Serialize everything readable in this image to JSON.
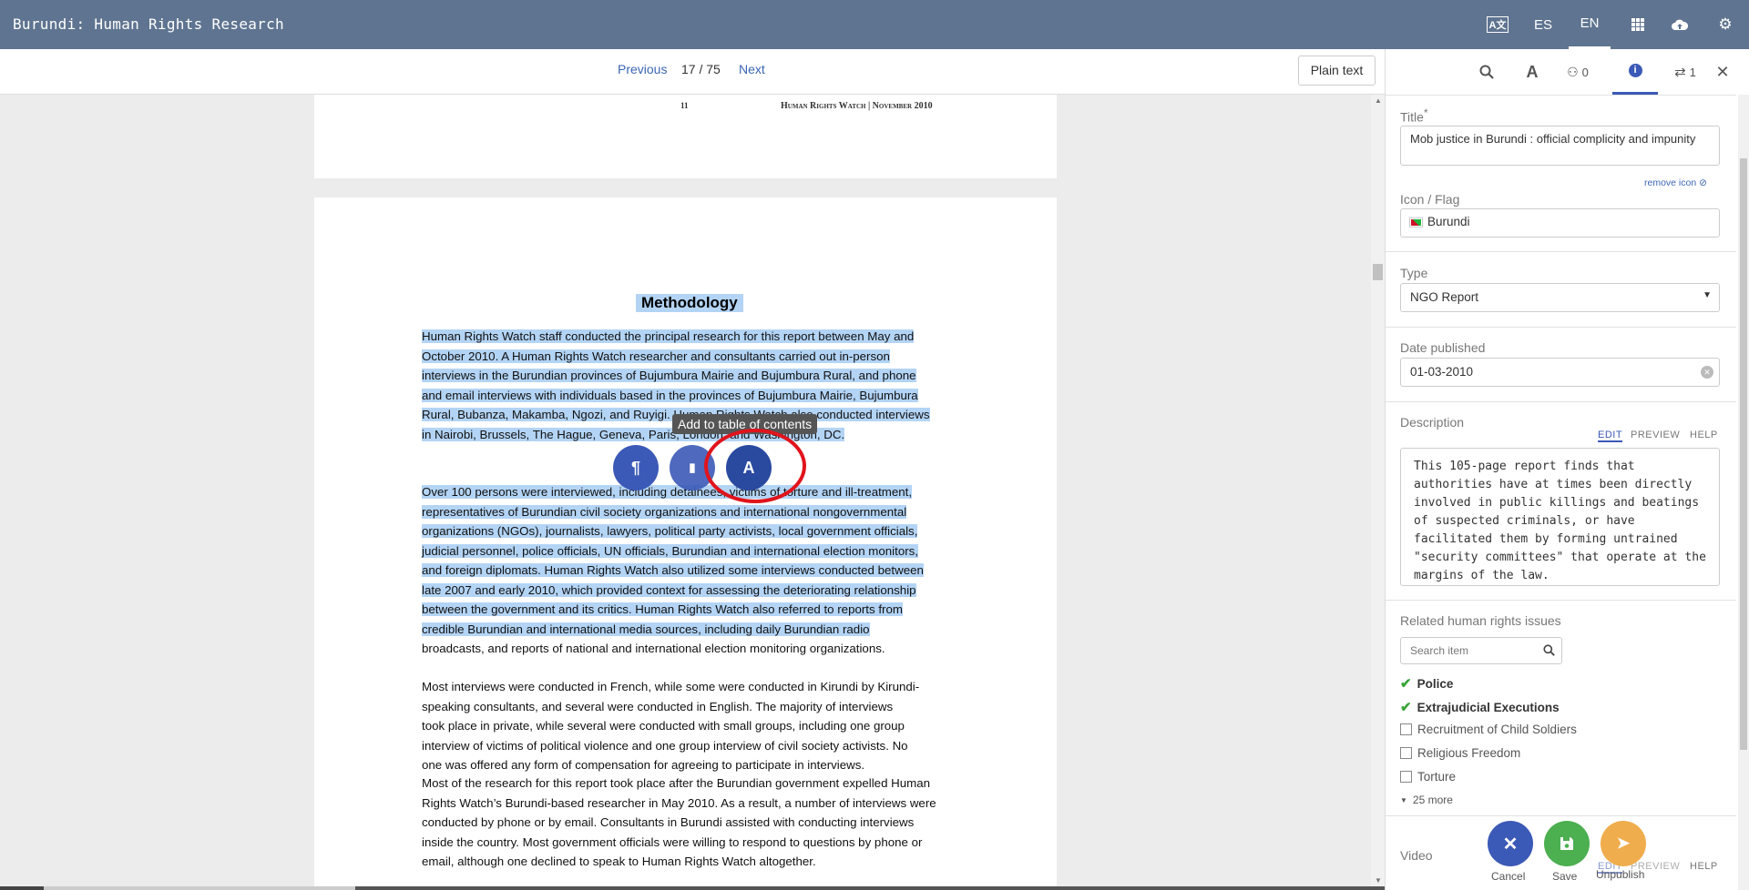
{
  "app": {
    "title": "Burundi: Human Rights Research"
  },
  "topbar": {
    "lang_icon": "A文",
    "languages": [
      "ES",
      "EN"
    ],
    "active_language": "EN",
    "icons": [
      "translate-icon",
      "grid-icon",
      "cloud-upload-icon",
      "gear-icon"
    ]
  },
  "pager": {
    "previous": "Previous",
    "position": "17 / 75",
    "next": "Next",
    "plain_text": "Plain text"
  },
  "document": {
    "prev_page_number": "11",
    "prev_page_header": "Human Rights Watch | November 2010",
    "heading": "Methodology",
    "paragraphs": [
      [
        "Human Rights Watch staff conducted the principal research for this report between May and",
        "October 2010. A Human Rights Watch researcher and consultants carried out in-person",
        "interviews in the Burundian provinces of Bujumbura Mairie and Bujumbura Rural, and phone",
        "and email interviews with individuals based in the provinces of Bujumbura Mairie, Bujumbura",
        "Rural, Bubanza, Makamba, Ngozi, and Ruyigi. Human Rights Watch also conducted interviews",
        "in Nairobi, Brussels, The Hague, Geneva, Paris, London, and Washington, DC."
      ],
      [
        "Over 100 persons were interviewed, including detainees, victims of torture and ill-treatment,",
        "representatives of Burundian civil society organizations and international nongovernmental",
        "organizations (NGOs), journalists, lawyers, political party activists, local government officials,",
        "judicial personnel, police officials, UN officials, Burundian and international election monitors,",
        "and foreign diplomats. Human Rights Watch also utilized some interviews conducted between",
        "late 2007 and early 2010, which provided context for assessing the deteriorating relationship",
        "between the government and its critics. Human Rights Watch also referred to reports from",
        "credible Burundian and international media sources, including daily Burundian radio",
        "broadcasts, and reports of national and international election monitoring organizations."
      ],
      [
        "Most interviews were conducted in French, while some were conducted in Kirundi by Kirundi-",
        "speaking consultants, and several were conducted in English. The majority of interviews",
        "took place in private, while several were conducted with small groups, including one group",
        "interview of victims of political violence and one group interview of civil society activists. No",
        "one was offered any form of compensation for agreeing to participate in interviews."
      ],
      [
        "Most of the research for this report took place after the Burundian government expelled Human",
        "Rights Watch’s Burundi-based researcher in May 2010. As a result, a number of interviews were",
        "conducted by phone or by email. Consultants in Burundi assisted with conducting interviews",
        "inside the country. Most government officials were willing to respond to questions by phone or",
        "email, although one declined to speak to Human Rights Watch altogether."
      ]
    ]
  },
  "selection_tools": {
    "tooltip": "Add to table of contents",
    "buttons": [
      "¶",
      "▮",
      "A"
    ]
  },
  "panel": {
    "tabs": {
      "relationships_count": "0",
      "connections_count": "1"
    },
    "title_label": "Title",
    "required_mark": "*",
    "title_value": "Mob justice in Burundi : official complicity and impunity",
    "remove_icon": "remove icon",
    "icon_label": "Icon / Flag",
    "icon_value": "Burundi",
    "type_label": "Type",
    "type_value": "NGO Report",
    "date_label": "Date published",
    "date_value": "01-03-2010",
    "description_label": "Description",
    "md_tabs": [
      "EDIT",
      "PREVIEW",
      "HELP"
    ],
    "description_value": "This 105-page report finds that authorities have at times been directly involved in public killings and beatings of suspected criminals, or have facilitated them by forming untrained \"security committees\" that operate at the margins of the law.",
    "issues_label": "Related human rights issues",
    "search_placeholder": "Search item",
    "issues": [
      {
        "label": "Police",
        "checked": true
      },
      {
        "label": "Extrajudicial Executions",
        "checked": true
      },
      {
        "label": "Recruitment of Child Soldiers",
        "checked": false
      },
      {
        "label": "Religious Freedom",
        "checked": false
      },
      {
        "label": "Torture",
        "checked": false
      }
    ],
    "more": "25 more",
    "video_label": "Video"
  },
  "actions": {
    "cancel": "Cancel",
    "save": "Save",
    "unpublish": "Unpublish"
  },
  "colors": {
    "topbar": "#5f7490",
    "accent": "#3b59b6",
    "selection": "#b3d4f5",
    "save": "#4caf50",
    "unpublish": "#f0ad4e",
    "highlight_ring": "#e0141c"
  }
}
